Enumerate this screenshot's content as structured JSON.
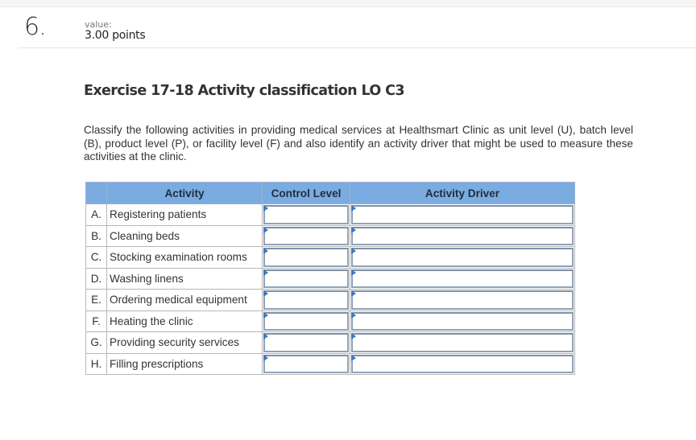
{
  "question": {
    "number": "6.",
    "value_label": "value:",
    "points": "3.00 points"
  },
  "exercise": {
    "title": "Exercise 17-18 Activity classification LO C3",
    "instructions": "Classify the following activities in providing medical services at Healthsmart Clinic as unit level (U), batch level (B), product level (P), or facility level (F) and also identify an activity driver that might be used to measure these activities at the clinic."
  },
  "table": {
    "headers": {
      "letter": "",
      "activity": "Activity",
      "control_level": "Control Level",
      "activity_driver": "Activity Driver"
    },
    "rows": [
      {
        "letter": "A.",
        "activity": "Registering patients",
        "control_level": "",
        "activity_driver": ""
      },
      {
        "letter": "B.",
        "activity": "Cleaning beds",
        "control_level": "",
        "activity_driver": ""
      },
      {
        "letter": "C.",
        "activity": "Stocking examination rooms",
        "control_level": "",
        "activity_driver": ""
      },
      {
        "letter": "D.",
        "activity": "Washing linens",
        "control_level": "",
        "activity_driver": ""
      },
      {
        "letter": "E.",
        "activity": "Ordering medical equipment",
        "control_level": "",
        "activity_driver": ""
      },
      {
        "letter": "F.",
        "activity": "Heating the clinic",
        "control_level": "",
        "activity_driver": ""
      },
      {
        "letter": "G.",
        "activity": "Providing security services",
        "control_level": "",
        "activity_driver": ""
      },
      {
        "letter": "H.",
        "activity": "Filling prescriptions",
        "control_level": "",
        "activity_driver": ""
      }
    ]
  },
  "colors": {
    "header_bg": "#7aace2",
    "input_marker": "#3d78c5",
    "input_border": "#8fa3b8"
  }
}
